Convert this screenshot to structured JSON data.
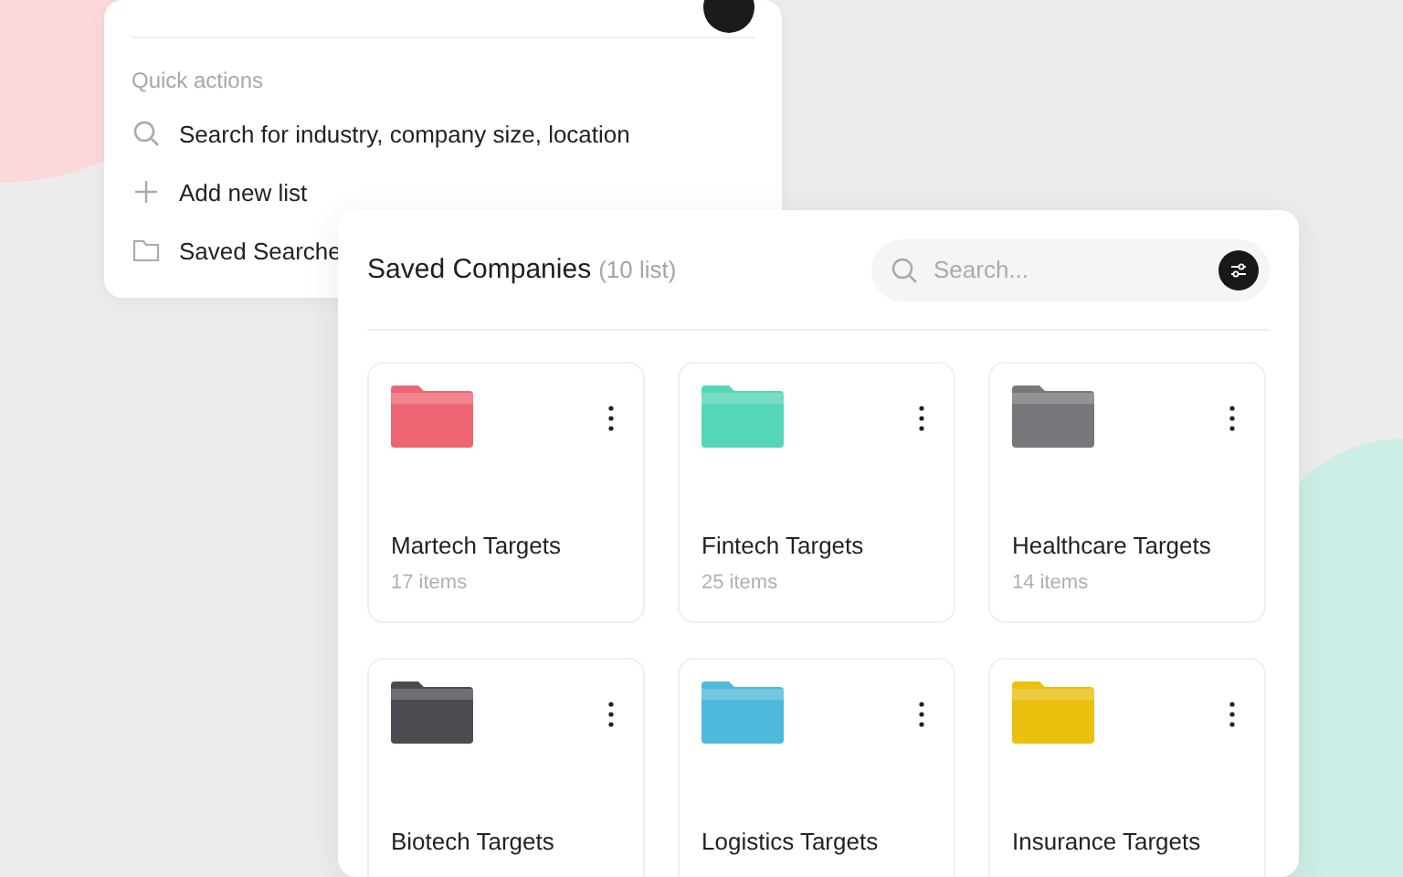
{
  "quick_panel": {
    "section_label": "Quick actions",
    "actions": [
      {
        "kind": "search",
        "label": "Search for industry, company size, location"
      },
      {
        "kind": "add",
        "label": "Add new list"
      },
      {
        "kind": "folder",
        "label": "Saved Searche"
      }
    ]
  },
  "saved_panel": {
    "title": "Saved Companies",
    "count": "(10 list)",
    "search": {
      "placeholder": "Search..."
    },
    "folders": [
      {
        "name": "Martech Targets",
        "count": "17 items",
        "color": "#ee6673"
      },
      {
        "name": "Fintech Targets",
        "count": "25 items",
        "color": "#55d6b8"
      },
      {
        "name": "Healthcare Targets",
        "count": "14 items",
        "color": "#78787c"
      },
      {
        "name": "Biotech Targets",
        "color": "#4a4c52"
      },
      {
        "name": "Logistics Targets",
        "color": "#4fb9dc"
      },
      {
        "name": "Insurance Targets",
        "color": "#ecc00f"
      }
    ]
  }
}
